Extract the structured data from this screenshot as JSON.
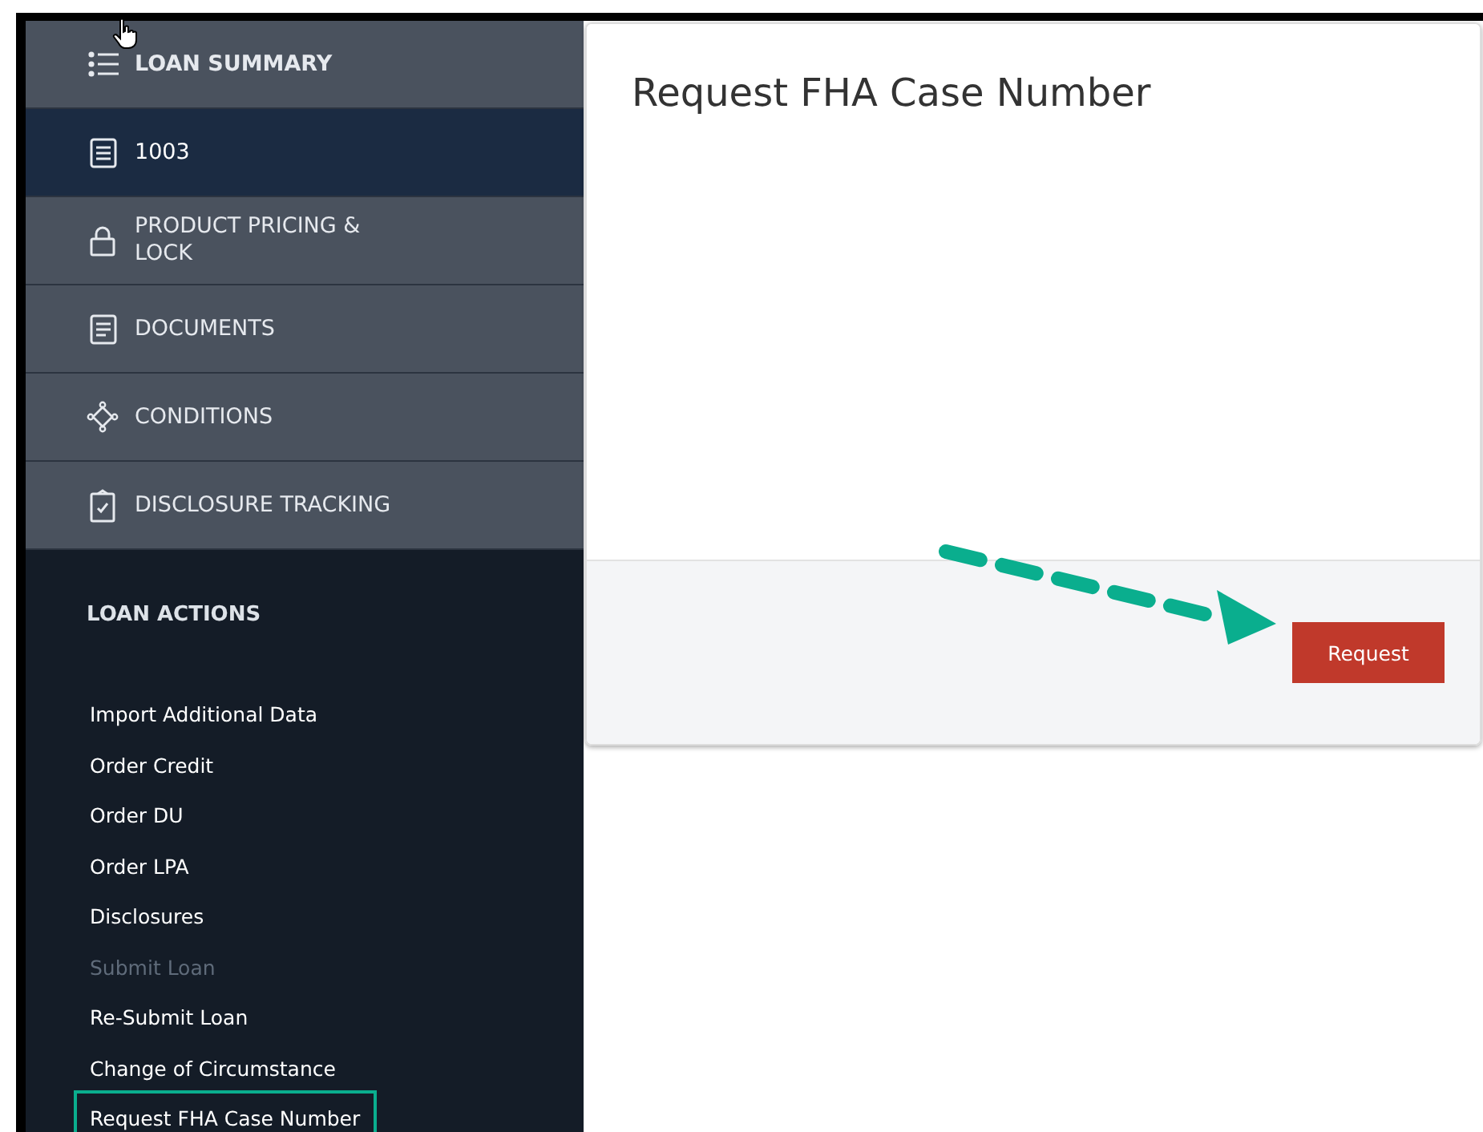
{
  "nav": [
    {
      "label": "LOAN SUMMARY",
      "selected": false,
      "bold": true
    },
    {
      "label": "1003",
      "selected": true,
      "bold": false
    },
    {
      "label": "PRODUCT PRICING & LOCK",
      "selected": false,
      "bold": false
    },
    {
      "label": "DOCUMENTS",
      "selected": false,
      "bold": false
    },
    {
      "label": "CONDITIONS",
      "selected": false,
      "bold": false
    },
    {
      "label": "DISCLOSURE TRACKING",
      "selected": false,
      "bold": false
    }
  ],
  "actions": {
    "title": "LOAN ACTIONS",
    "items": [
      {
        "label": "Import Additional Data",
        "disabled": false,
        "highlighted": false
      },
      {
        "label": "Order Credit",
        "disabled": false,
        "highlighted": false
      },
      {
        "label": "Order DU",
        "disabled": false,
        "highlighted": false
      },
      {
        "label": "Order LPA",
        "disabled": false,
        "highlighted": false
      },
      {
        "label": "Disclosures",
        "disabled": false,
        "highlighted": false
      },
      {
        "label": "Submit Loan",
        "disabled": true,
        "highlighted": false
      },
      {
        "label": "Re-Submit Loan",
        "disabled": false,
        "highlighted": false
      },
      {
        "label": "Change of Circumstance",
        "disabled": false,
        "highlighted": false
      },
      {
        "label": "Request FHA Case Number",
        "disabled": false,
        "highlighted": true
      }
    ]
  },
  "dialog": {
    "title": "Request FHA Case Number",
    "button": "Request"
  }
}
